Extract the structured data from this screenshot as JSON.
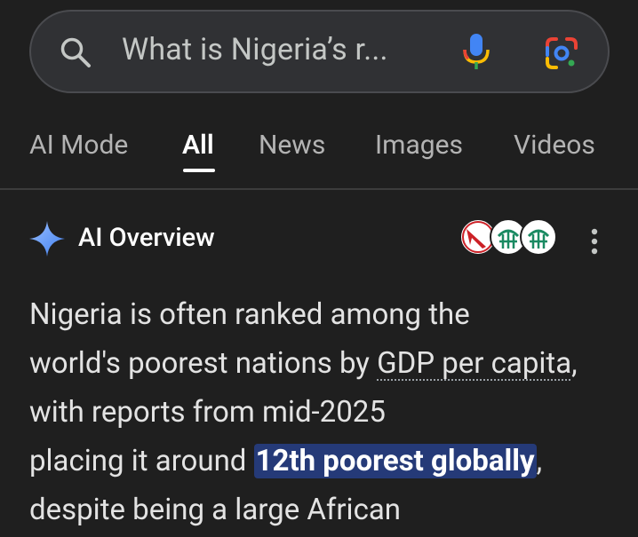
{
  "search": {
    "query": "What is Nigeria’s r...",
    "icons": [
      "search-icon",
      "mic-icon",
      "google-lens-icon"
    ]
  },
  "tabs": [
    {
      "label": "AI Mode",
      "active": false
    },
    {
      "label": "All",
      "active": true
    },
    {
      "label": "News",
      "active": false
    },
    {
      "label": "Images",
      "active": false
    },
    {
      "label": "Videos",
      "active": false
    }
  ],
  "ai_overview": {
    "title": "AI Overview",
    "sources": [
      "source-logo-red-arrow",
      "source-logo-green-globe",
      "source-logo-green-globe"
    ],
    "body": {
      "line1": "Nigeria is often ranked among the",
      "line2a": "world's poorest nations by ",
      "link1": "GDP per capita",
      "line3b": ", with reports from mid-2025",
      "line4a": "placing it around ",
      "highlight": "12th poorest globally",
      "line5b": ", despite being a large African"
    }
  },
  "colors": {
    "background": "#1f1f1f",
    "search_bg": "#303134",
    "highlight_bg": "#253a78",
    "sparkle": "#4a8af4"
  }
}
